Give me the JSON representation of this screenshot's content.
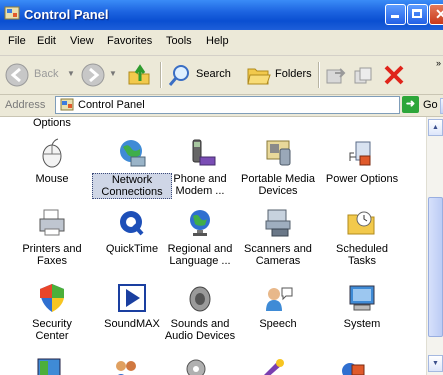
{
  "window": {
    "title": "Control Panel"
  },
  "menu": [
    "File",
    "Edit",
    "View",
    "Favorites",
    "Tools",
    "Help"
  ],
  "toolbar": {
    "back": "Back",
    "search": "Search",
    "folders": "Folders"
  },
  "address": {
    "label": "Address",
    "value": "Control Panel",
    "go": "Go"
  },
  "items": [
    {
      "label": "Mouse",
      "icon": "mouse-icon"
    },
    {
      "label": "Network\nConnections",
      "icon": "network-connections-icon",
      "selected": true
    },
    {
      "label": "Phone and\nModem ...",
      "icon": "phone-modem-icon"
    },
    {
      "label": "Portable Media\nDevices",
      "icon": "portable-media-icon"
    },
    {
      "label": "Power Options",
      "icon": "power-options-icon"
    },
    {
      "label": "Printers and\nFaxes",
      "icon": "printers-faxes-icon"
    },
    {
      "label": "QuickTime",
      "icon": "quicktime-icon"
    },
    {
      "label": "Regional and\nLanguage ...",
      "icon": "regional-language-icon"
    },
    {
      "label": "Scanners and\nCameras",
      "icon": "scanners-cameras-icon"
    },
    {
      "label": "Scheduled\nTasks",
      "icon": "scheduled-tasks-icon"
    },
    {
      "label": "Security\nCenter",
      "icon": "security-center-icon"
    },
    {
      "label": "SoundMAX",
      "icon": "soundmax-icon"
    },
    {
      "label": "Sounds and\nAudio Devices",
      "icon": "sounds-audio-icon"
    },
    {
      "label": "Speech",
      "icon": "speech-icon"
    },
    {
      "label": "System",
      "icon": "system-icon"
    }
  ]
}
